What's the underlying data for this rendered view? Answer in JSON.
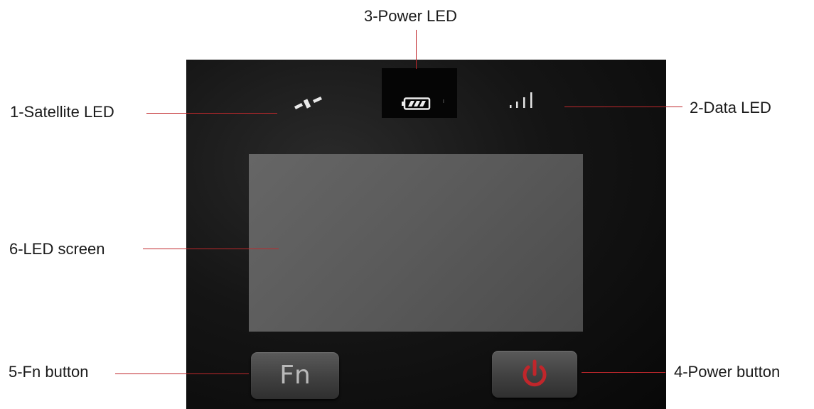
{
  "callouts": {
    "satellite_led": "1-Satellite LED",
    "data_led": "2-Data LED",
    "power_led": "3-Power LED",
    "power_button": "4-Power button",
    "fn_button": "5-Fn button",
    "led_screen": "6-LED screen"
  },
  "device": {
    "fn_label": "Fn",
    "icons": [
      "satellite-icon",
      "battery-icon",
      "signal-bars-icon",
      "power-symbol-icon"
    ]
  },
  "colors": {
    "callout_line": "#c0282c",
    "power_symbol": "#c0262b",
    "device_body": "#111111",
    "screen": "#5e5e5e"
  }
}
